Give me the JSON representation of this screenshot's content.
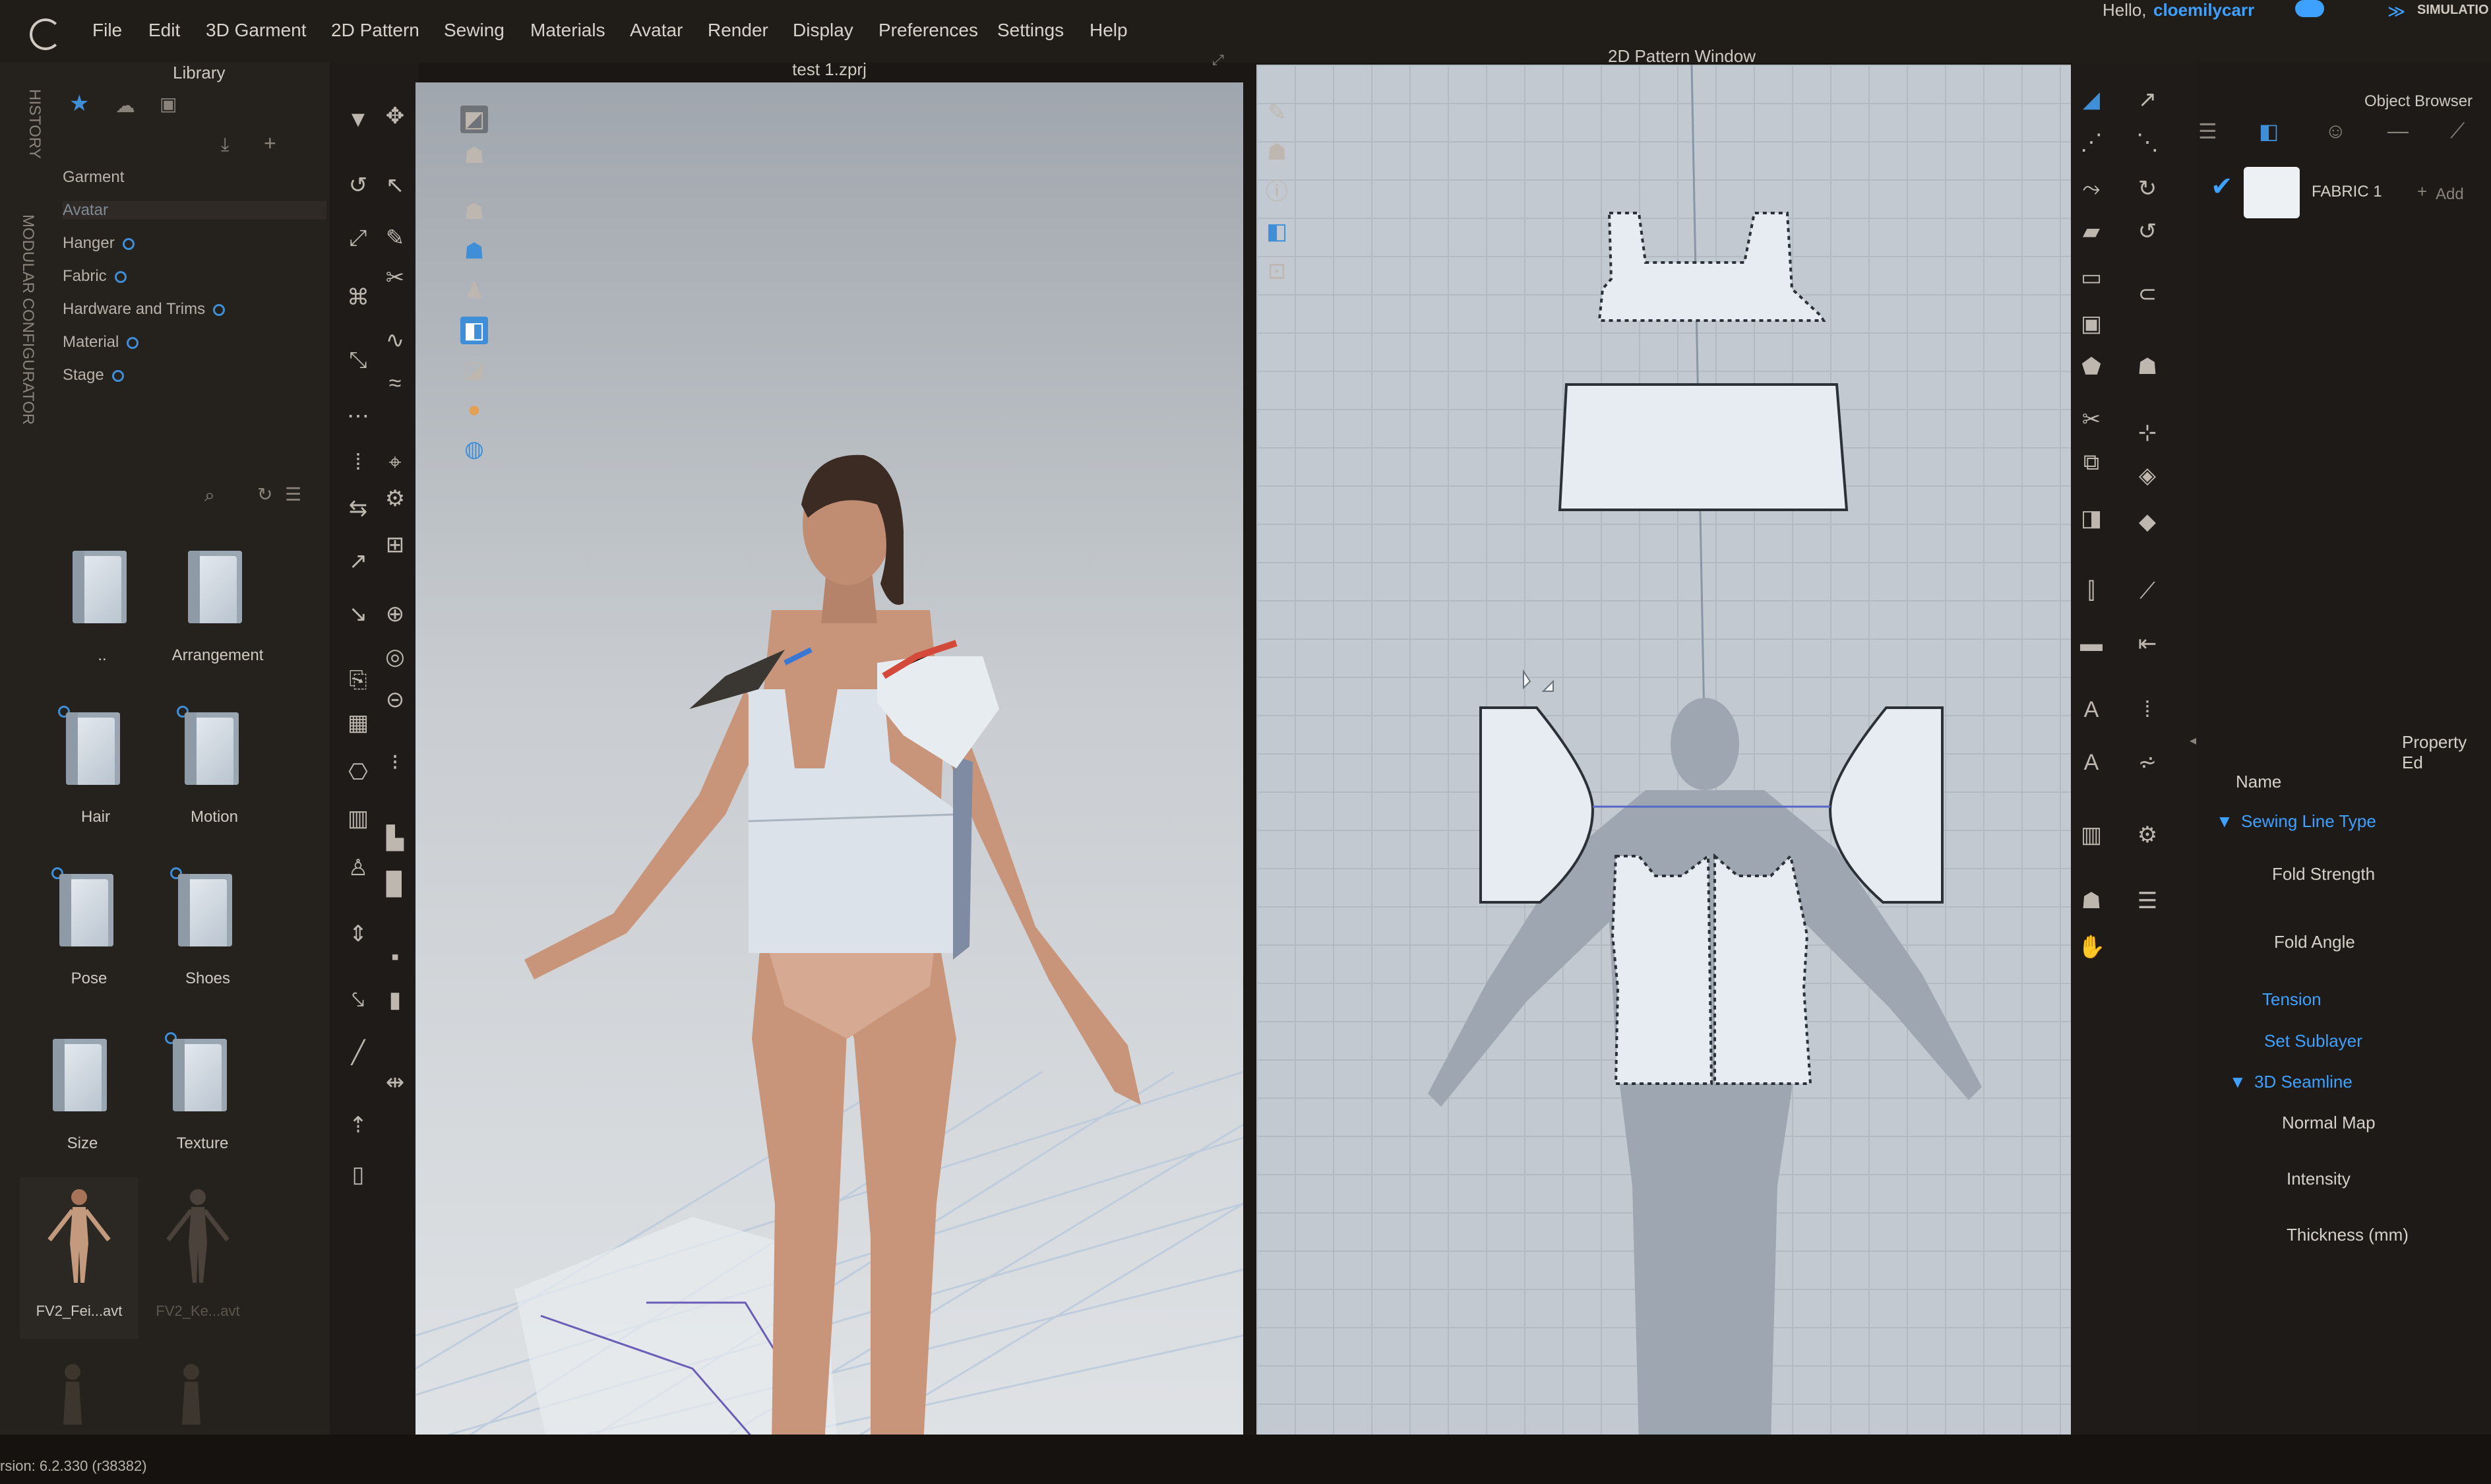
{
  "menubar": {
    "items": [
      "File",
      "Edit",
      "3D Garment",
      "2D Pattern",
      "Sewing",
      "Materials",
      "Avatar",
      "Render",
      "Display",
      "Preferences",
      "Settings",
      "Help"
    ],
    "greeting_prefix": "Hello,",
    "username": "cloemilycarr",
    "simulation_label": "SIMULATIO"
  },
  "library": {
    "title": "Library",
    "vertical_tabs": [
      "HISTORY",
      "MODULAR CONFIGURATOR"
    ],
    "categories": [
      "Garment",
      "Avatar",
      "Hanger",
      "Fabric",
      "Hardware and Trims",
      "Material",
      "Stage"
    ],
    "folders": [
      {
        "label": ".."
      },
      {
        "label": "Arrangement"
      },
      {
        "label": "Hair"
      },
      {
        "label": "Motion"
      },
      {
        "label": "Pose"
      },
      {
        "label": "Shoes"
      },
      {
        "label": "Size"
      },
      {
        "label": "Texture"
      }
    ],
    "avatars": [
      {
        "label": "FV2_Fei...avt"
      },
      {
        "label": "FV2_Ke...avt"
      }
    ]
  },
  "viewport3d": {
    "title": "test 1.zprj"
  },
  "viewport2d": {
    "title": "2D Pattern Window"
  },
  "object_browser": {
    "title": "Object Browser",
    "add_label": "Add",
    "fabric_name": "FABRIC 1"
  },
  "property_editor": {
    "title": "Property Ed",
    "fields": [
      {
        "label": "Name",
        "style": "normal"
      },
      {
        "label": "Sewing Line Type",
        "style": "blue"
      },
      {
        "label": "Fold Strength",
        "style": "normal"
      },
      {
        "label": "Fold Angle",
        "style": "normal"
      },
      {
        "label": "Tension",
        "style": "blue"
      },
      {
        "label": "Set Sublayer",
        "style": "blue"
      },
      {
        "label": "3D Seamline",
        "style": "blue"
      },
      {
        "label": "Normal Map",
        "style": "normal"
      },
      {
        "label": "Intensity",
        "style": "normal"
      },
      {
        "label": "Thickness (mm)",
        "style": "normal"
      }
    ]
  },
  "footer": {
    "version": "rsion: 6.2.330 (r38382)"
  },
  "colors": {
    "accent": "#3ea0ff",
    "panel": "#25211d",
    "viewport_bg": "#c9cdd1"
  }
}
